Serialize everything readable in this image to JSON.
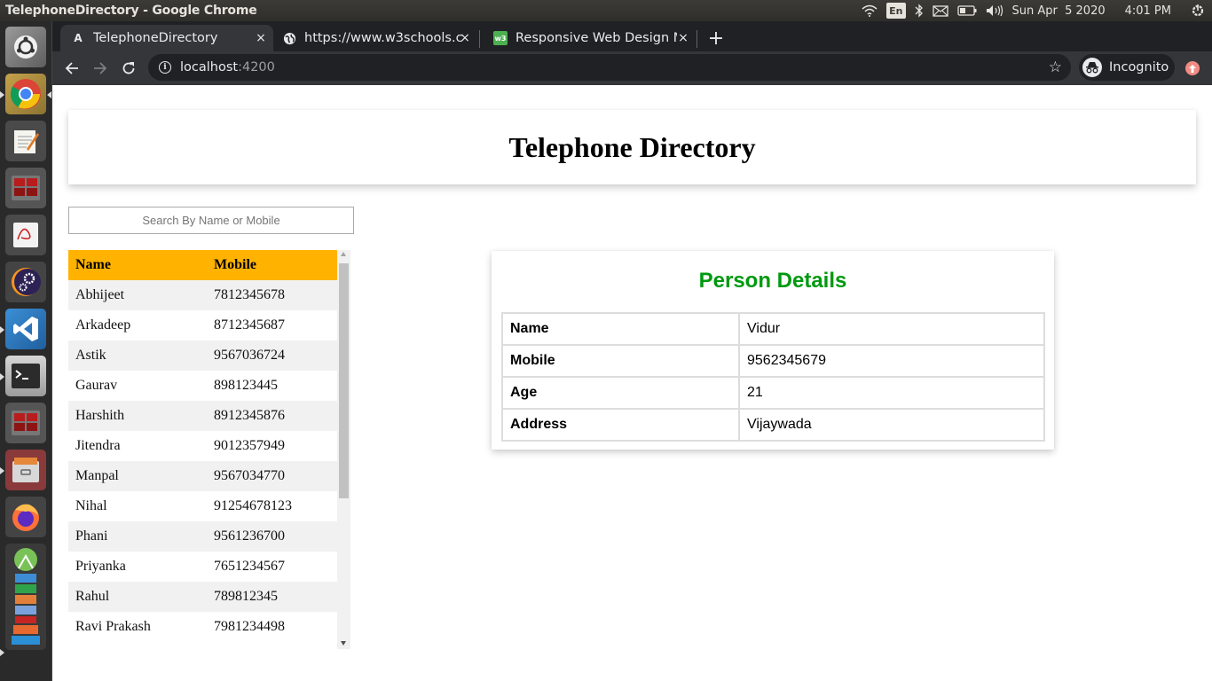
{
  "os": {
    "window_title": "TelephoneDirectory - Google Chrome",
    "indicators": {
      "keyboard_layout": "En",
      "date": "Sun Apr  5 2020",
      "time": "4:01 PM"
    },
    "launcher": [
      {
        "name": "ubuntu-dash-icon"
      },
      {
        "name": "chrome-icon",
        "running": true
      },
      {
        "name": "text-editor-icon"
      },
      {
        "name": "workspace-switcher-icon"
      },
      {
        "name": "document-viewer-icon"
      },
      {
        "name": "eclipse-icon"
      },
      {
        "name": "vscode-icon",
        "running": true
      },
      {
        "name": "terminal-icon",
        "running": true
      },
      {
        "name": "workspace-switcher-icon-2"
      },
      {
        "name": "file-manager-icon",
        "running": true
      },
      {
        "name": "firefox-icon"
      },
      {
        "name": "android-studio-icon"
      }
    ]
  },
  "browser": {
    "tabs": [
      {
        "title": "TelephoneDirectory",
        "favicon": "A",
        "active": true
      },
      {
        "title": "https://www.w3schools.c",
        "favicon": "globe",
        "active": false
      },
      {
        "title": "Responsive Web Design M",
        "favicon": "w3",
        "active": false
      }
    ],
    "close_glyph": "×",
    "new_tab_glyph": "+",
    "url_host": "localhost",
    "url_port": ":4200",
    "profile_label": "Incognito"
  },
  "page": {
    "title": "Telephone Directory",
    "search_placeholder": "Search By Name or Mobile",
    "search_value": "",
    "list": {
      "headers": [
        "Name",
        "Mobile"
      ],
      "rows": [
        {
          "name": "Abhijeet",
          "mobile": "7812345678"
        },
        {
          "name": "Arkadeep",
          "mobile": "8712345687"
        },
        {
          "name": "Astik",
          "mobile": "9567036724"
        },
        {
          "name": "Gaurav",
          "mobile": "898123445"
        },
        {
          "name": "Harshith",
          "mobile": "8912345876"
        },
        {
          "name": "Jitendra",
          "mobile": "9012357949"
        },
        {
          "name": "Manpal",
          "mobile": "9567034770"
        },
        {
          "name": "Nihal",
          "mobile": "91254678123"
        },
        {
          "name": "Phani",
          "mobile": "9561236700"
        },
        {
          "name": "Priyanka",
          "mobile": "7651234567"
        },
        {
          "name": "Rahul",
          "mobile": "789812345"
        },
        {
          "name": "Ravi Prakash",
          "mobile": "7981234498"
        }
      ],
      "header_color": "#ffb300"
    },
    "details": {
      "title": "Person Details",
      "title_color": "#00990f",
      "fields": [
        {
          "label": "Name",
          "value": "Vidur"
        },
        {
          "label": "Mobile",
          "value": "9562345679"
        },
        {
          "label": "Age",
          "value": "21"
        },
        {
          "label": "Address",
          "value": "Vijaywada"
        }
      ]
    }
  }
}
